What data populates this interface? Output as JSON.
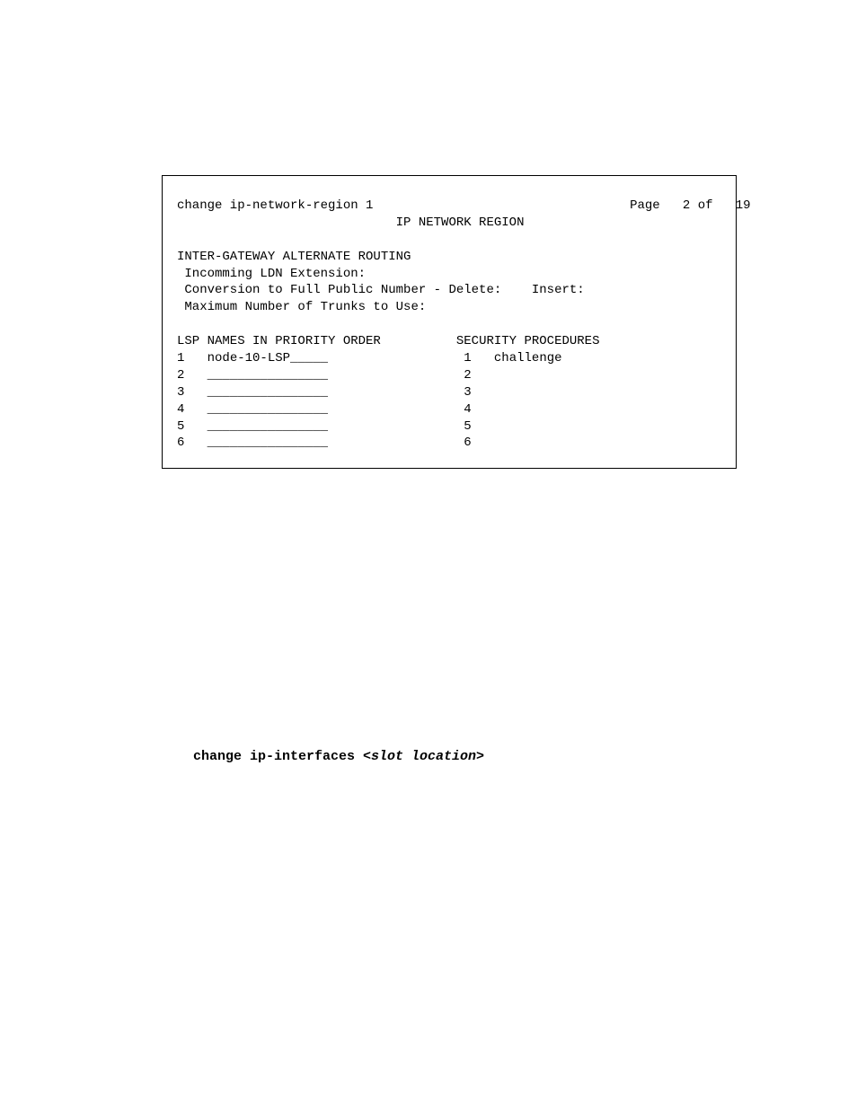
{
  "terminal": {
    "header": {
      "command": "change ip-network-region 1",
      "page_label": "Page",
      "page_current": "2",
      "page_of": "of",
      "page_total": "19",
      "title": "IP NETWORK REGION"
    },
    "igar": {
      "section_title": "INTER-GATEWAY ALTERNATE ROUTING",
      "line1": " Incomming LDN Extension:",
      "line2": " Conversion to Full Public Number - Delete:    Insert:",
      "line3": " Maximum Number of Trunks to Use:"
    },
    "lsp": {
      "title": "LSP NAMES IN PRIORITY ORDER",
      "rows": [
        {
          "num": "1",
          "value": "node-10-LSP_____"
        },
        {
          "num": "2",
          "value": "________________"
        },
        {
          "num": "3",
          "value": "________________"
        },
        {
          "num": "4",
          "value": "________________"
        },
        {
          "num": "5",
          "value": "________________"
        },
        {
          "num": "6",
          "value": "________________"
        }
      ]
    },
    "security": {
      "title": "SECURITY PROCEDURES",
      "rows": [
        {
          "num": "1",
          "value": "challenge"
        },
        {
          "num": "2",
          "value": ""
        },
        {
          "num": "3",
          "value": ""
        },
        {
          "num": "4",
          "value": ""
        },
        {
          "num": "5",
          "value": ""
        },
        {
          "num": "6",
          "value": ""
        }
      ]
    }
  },
  "command_text": {
    "prefix": "change ip-interfaces ",
    "arg": "<slot location>"
  }
}
